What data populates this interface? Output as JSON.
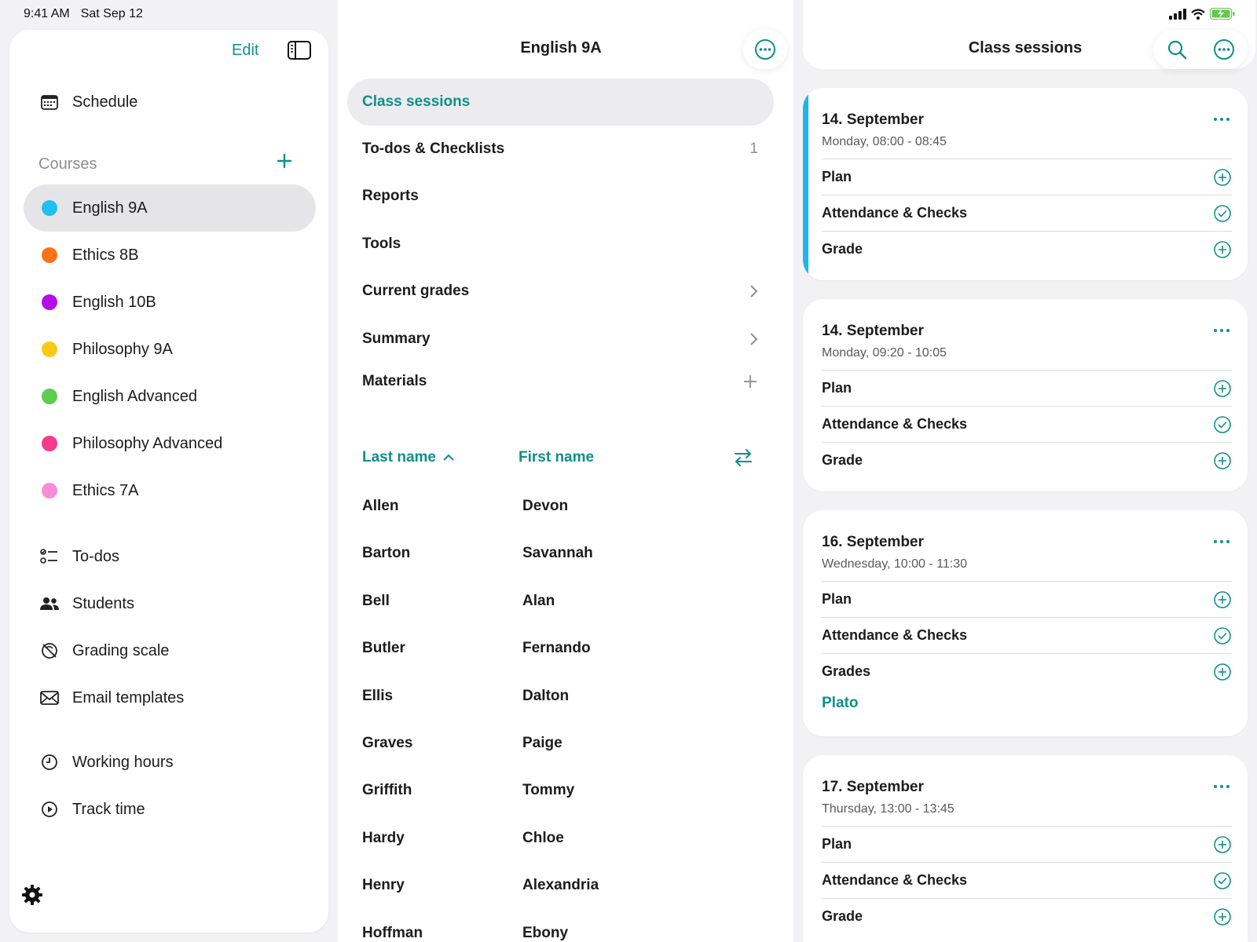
{
  "status": {
    "time": "9:41 AM",
    "date": "Sat Sep 12"
  },
  "sidebar": {
    "edit_label": "Edit",
    "schedule_label": "Schedule",
    "courses_label": "Courses",
    "courses": [
      {
        "label": "English 9A",
        "color": "#1fbff0",
        "selected": true
      },
      {
        "label": "Ethics 8B",
        "color": "#f97316"
      },
      {
        "label": "English 10B",
        "color": "#b30ee8"
      },
      {
        "label": "Philosophy 9A",
        "color": "#fbc916"
      },
      {
        "label": "English Advanced",
        "color": "#5ccd4f"
      },
      {
        "label": "Philosophy Advanced",
        "color": "#f43b8d"
      },
      {
        "label": "Ethics 7A",
        "color": "#f98bd9"
      }
    ],
    "tools": [
      {
        "label": "To-dos",
        "icon": "checklist-icon"
      },
      {
        "label": "Students",
        "icon": "people-icon"
      },
      {
        "label": "Grading scale",
        "icon": "grading-scale-icon"
      },
      {
        "label": "Email templates",
        "icon": "envelope-icon"
      }
    ],
    "time_items": [
      {
        "label": "Working hours",
        "icon": "clock-icon"
      },
      {
        "label": "Track time",
        "icon": "play-circle-icon"
      }
    ]
  },
  "middle": {
    "title": "English 9A",
    "menu": [
      {
        "label": "Class sessions",
        "selected": true
      },
      {
        "label": "To-dos & Checklists",
        "count": "1"
      },
      {
        "label": "Reports"
      },
      {
        "label": "Tools"
      },
      {
        "label": "Current grades",
        "accessory": "chevron"
      },
      {
        "label": "Summary",
        "accessory": "chevron"
      },
      {
        "label": "Materials",
        "accessory": "plus"
      }
    ],
    "columns": {
      "last": "Last name",
      "first": "First name"
    },
    "students": [
      {
        "last": "Allen",
        "first": "Devon"
      },
      {
        "last": "Barton",
        "first": "Savannah"
      },
      {
        "last": "Bell",
        "first": "Alan"
      },
      {
        "last": "Butler",
        "first": "Fernando"
      },
      {
        "last": "Ellis",
        "first": "Dalton"
      },
      {
        "last": "Graves",
        "first": "Paige"
      },
      {
        "last": "Griffith",
        "first": "Tommy"
      },
      {
        "last": "Hardy",
        "first": "Chloe"
      },
      {
        "last": "Henry",
        "first": "Alexandria"
      },
      {
        "last": "Hoffman",
        "first": "Ebony"
      }
    ]
  },
  "right": {
    "title": "Class sessions",
    "sessions": [
      {
        "date": "14. September",
        "time": "Monday, 08:00 - 08:45",
        "accent": true,
        "rows": [
          {
            "label": "Plan",
            "icon": "plus-circle-icon"
          },
          {
            "label": "Attendance & Checks",
            "icon": "check-circle-icon"
          },
          {
            "label": "Grade",
            "icon": "plus-circle-icon"
          }
        ]
      },
      {
        "date": "14. September",
        "time": "Monday, 09:20 - 10:05",
        "rows": [
          {
            "label": "Plan",
            "icon": "plus-circle-icon"
          },
          {
            "label": "Attendance & Checks",
            "icon": "check-circle-icon"
          },
          {
            "label": "Grade",
            "icon": "plus-circle-icon"
          }
        ]
      },
      {
        "date": "16. September",
        "time": "Wednesday, 10:00 - 11:30",
        "extra": "Plato",
        "rows": [
          {
            "label": "Plan",
            "icon": "plus-circle-icon"
          },
          {
            "label": "Attendance & Checks",
            "icon": "check-circle-icon"
          },
          {
            "label": "Grades",
            "icon": "plus-circle-icon"
          }
        ]
      },
      {
        "date": "17. September",
        "time": "Thursday, 13:00 - 13:45",
        "rows": [
          {
            "label": "Plan",
            "icon": "plus-circle-icon"
          },
          {
            "label": "Attendance & Checks",
            "icon": "check-circle-icon"
          },
          {
            "label": "Grade",
            "icon": "plus-circle-icon"
          }
        ]
      }
    ]
  },
  "colors": {
    "accent": "#0f8f8c",
    "selected_bg": "#e5e5e8"
  }
}
